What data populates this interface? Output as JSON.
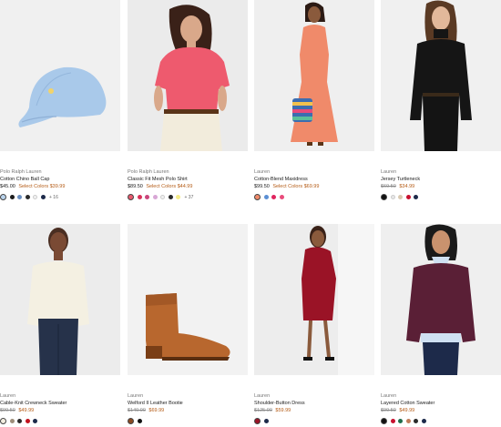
{
  "products": [
    {
      "brand": "Polo Ralph Lauren",
      "name": "Cotton Chino Ball Cap",
      "price_regular": "$45.00",
      "price_label": "Select Colors $39.99",
      "swatches": [
        "#b9d3ec",
        "#1b1b1b",
        "#6b8fc1",
        "#2a2a2a",
        "#f1f1f1",
        "#1d2a4a"
      ],
      "more": "+ 16"
    },
    {
      "brand": "Polo Ralph Lauren",
      "name": "Classic Fit Mesh Polo Shirt",
      "price_regular": "$89.50",
      "price_label": "Select Colors $44.99",
      "swatches": [
        "#e85a6e",
        "#d9335a",
        "#c9467c",
        "#d8a7d6",
        "#f2f2f2",
        "#2a2a2a",
        "#f5ec8a"
      ],
      "more": "+ 37"
    },
    {
      "brand": "Lauren",
      "name": "Cotton-Blend Maxidress",
      "price_regular": "$99.50",
      "price_label": "Select Colors $69.99",
      "swatches": [
        "#f08a6a",
        "#5b8fd4",
        "#e0245e",
        "#e94b7b"
      ],
      "more": ""
    },
    {
      "brand": "Lauren",
      "name": "Jersey Turtleneck",
      "price_original": "$69.50",
      "price_sale": "$34.99",
      "swatches": [
        "#111111",
        "#e8e8e8",
        "#d9c9b0",
        "#c8102e",
        "#1d2a4a"
      ],
      "more": ""
    },
    {
      "brand": "Lauren",
      "name": "Cable-Knit Crewneck Sweater",
      "price_original": "$99.50",
      "price_sale": "$49.99",
      "swatches": [
        "#f3efe1",
        "#9e8e7a",
        "#2a2a2a",
        "#c2121d",
        "#1d2a4a"
      ],
      "more": ""
    },
    {
      "brand": "Lauren",
      "name": "Welford II Leather Bootie",
      "price_original": "$140.00",
      "price_sale": "$69.99",
      "swatches": [
        "#8a4a22",
        "#111111"
      ],
      "more": ""
    },
    {
      "brand": "Lauren",
      "name": "Shoulder-Button Dress",
      "price_original": "$125.00",
      "price_sale": "$59.99",
      "swatches": [
        "#9a1326",
        "#1d2a4a"
      ],
      "more": ""
    },
    {
      "brand": "Lauren",
      "name": "Layered Cotton Sweater",
      "price_original": "$99.50",
      "price_sale": "$49.99",
      "swatches": [
        "#111111",
        "#c8102e",
        "#1d6b4a",
        "#c17d5a",
        "#2a2a2a",
        "#1d2a4a"
      ],
      "more": ""
    }
  ]
}
